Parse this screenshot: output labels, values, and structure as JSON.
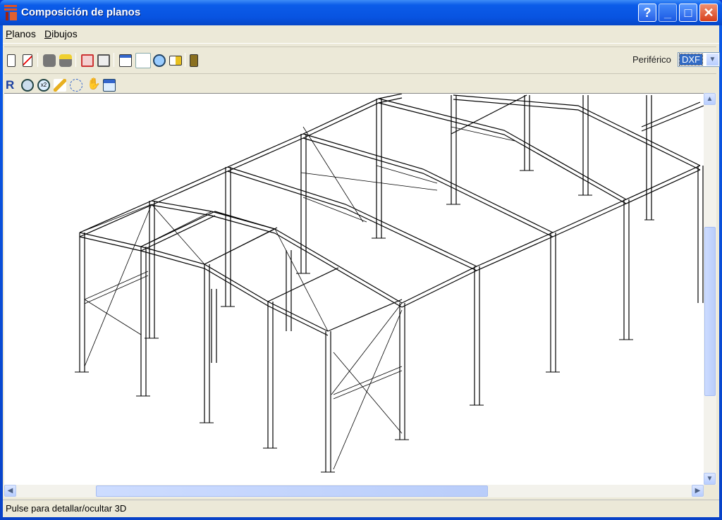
{
  "window": {
    "title": "Composición de planos",
    "buttons": {
      "help": "?",
      "minimize": "_",
      "maximize": "□",
      "close": "✕"
    }
  },
  "menu": [
    {
      "label": "Planos",
      "accel": "P",
      "rest": "lanos"
    },
    {
      "label": "Dibujos",
      "accel": "D",
      "rest": "ibujos"
    }
  ],
  "toolbar1": {
    "icons": [
      "new-plan-icon",
      "delete-plan-icon",
      "print-icon",
      "print-setup-icon",
      "move-drawing-icon",
      "arrange-drawings-icon",
      "plan-layout-icon",
      "edit-drawing-icon",
      "preview-3d-icon",
      "export-icon",
      "exit-icon"
    ],
    "peripheral_label": "Periférico",
    "peripheral_value": "DXF"
  },
  "toolbar2": {
    "icons": [
      "zoom-redraw-icon",
      "zoom-extents-icon",
      "zoom-x2-icon",
      "zoom-window-icon",
      "zoom-previous-icon",
      "pan-hand-icon",
      "refresh-view-icon"
    ]
  },
  "status": "Pulse para detallar/ocultar 3D",
  "colors": {
    "titlebar": "#0853e0",
    "face": "#ece9d8",
    "selection": "#316ac5"
  }
}
